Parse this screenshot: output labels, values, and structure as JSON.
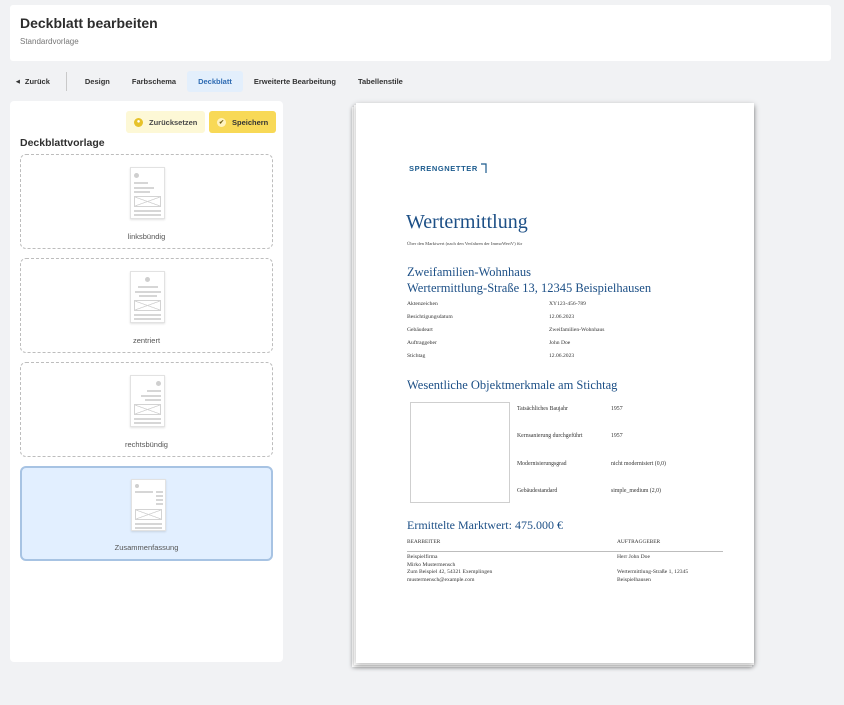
{
  "header": {
    "title": "Deckblatt bearbeiten",
    "subtitle": "Standardvorlage"
  },
  "tabs": [
    {
      "label": "Zurück"
    },
    {
      "label": "Design"
    },
    {
      "label": "Farbschema"
    },
    {
      "label": "Deckblatt",
      "active": true
    },
    {
      "label": "Erweiterte Bearbeitung"
    },
    {
      "label": "Tabellenstile"
    }
  ],
  "panel": {
    "reset_label": "Zurücksetzen",
    "save_label": "Speichern",
    "heading": "Deckblattvorlage",
    "templates": [
      {
        "label": "linksbündig"
      },
      {
        "label": "zentriert"
      },
      {
        "label": "rechtsbündig"
      },
      {
        "label": "Zusammenfassung",
        "selected": true
      }
    ]
  },
  "doc": {
    "logo": "SPRENGNETTER",
    "title": "Wertermittlung",
    "subtitle": "Über den Marktwert (nach den Verfahren der ImmoWertV) für",
    "object_type": "Zweifamilien-Wohnhaus",
    "address": "Wertermittlung-Straße 13, 12345 Beispielhausen",
    "details": [
      {
        "key": "Aktenzeichen",
        "value": "XY123-456-789"
      },
      {
        "key": "Besichtigungsdatum",
        "value": "12.06.2023"
      },
      {
        "key": "Gebäudeart",
        "value": "Zweifamilien-Wohnhaus"
      },
      {
        "key": "Auftraggeber",
        "value": "John Doe"
      },
      {
        "key": "Stichtag",
        "value": "12.06.2023"
      }
    ],
    "features_heading": "Wesentliche Objektmerkmale am Stichtag",
    "features": [
      {
        "key": "Tatsächliches Baujahr",
        "value": "1957"
      },
      {
        "key": "Kernsanierung durchgeführt",
        "value": "1957"
      },
      {
        "key": "Modernisierungsgrad",
        "value": "nicht modernisiert (0,0)"
      },
      {
        "key": "Gebäudestandard",
        "value": "simple_medium (2,0)"
      }
    ],
    "value_heading": "Ermittelte Marktwert: 475.000 €",
    "editor_header": "BEARBEITER",
    "client_header": "AUFTRAGGEBER",
    "editor_lines": "Beispielfirma\nMirko Mustermensch\nZum Beispiel 42, 54321 Exemplingen\nmustermensch@example.com",
    "client_lines": "Herr John Doe\n\nWertermittlung-Straße 1, 12345\nBeispielhausen"
  }
}
